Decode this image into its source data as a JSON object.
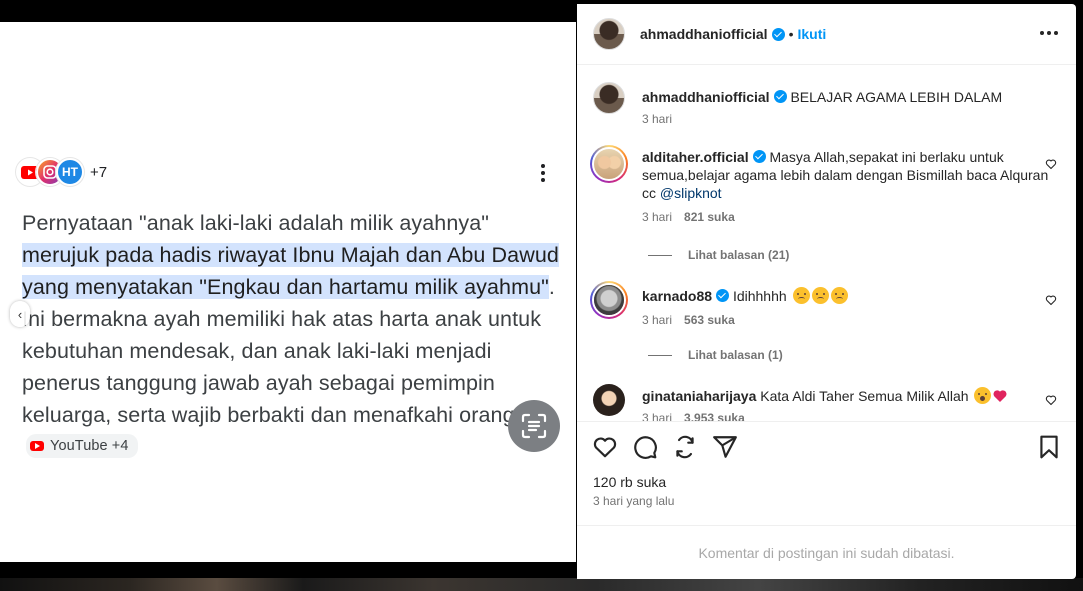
{
  "image": {
    "source_count": "+7",
    "text_before": "Pernyataan \"anak laki-laki adalah milik ayahnya\" ",
    "highlight": "merujuk pada hadis riwayat Ibnu Majah dan Abu Dawud yang menyatakan \"Engkau dan hartamu milik ayahmu\"",
    "text_after": ". Ini bermakna ayah memiliki hak atas harta anak untuk kebutuhan mendesak, dan anak laki-laki menjadi penerus tanggung jawab ayah sebagai pemimpin keluarga, serta wajib berbakti dan menafkahi orang tua.",
    "chip_label": "YouTube +4"
  },
  "post": {
    "username": "ahmaddhaniofficial",
    "separator": "•",
    "follow_label": "Ikuti",
    "caption": "BELAJAR AGAMA LEBIH DALAM",
    "caption_time": "3 hari",
    "comments": [
      {
        "username": "alditaher.official",
        "text": "Masya Allah,sepakat ini berlaku untuk semua,belajar agama lebih dalam dengan Bismillah baca Alquran cc ",
        "mention": "@slipknot",
        "time": "3 hari",
        "likes": "821 suka",
        "replies": "Lihat balasan (21)"
      },
      {
        "username": "karnado88",
        "text": "Idihhhhh",
        "time": "3 hari",
        "likes": "563 suka",
        "replies": "Lihat balasan (1)"
      },
      {
        "username": "ginataniaharijaya",
        "text": "Kata Aldi Taher Semua Milik Allah",
        "time": "3 hari",
        "likes": "3.953 suka"
      }
    ],
    "likes_total": "120 rb suka",
    "posted_time": "3 hari yang lalu",
    "comments_limited": "Komentar di postingan ini sudah dibatasi."
  },
  "colors": {
    "accent": "#0095f6",
    "highlight": "#d3e3fd",
    "muted": "#737373"
  },
  "icons": [
    "youtube-icon",
    "instagram-icon",
    "more-vert-icon",
    "lens-icon",
    "heart-icon",
    "comment-icon",
    "repost-icon",
    "share-icon",
    "bookmark-icon",
    "verified-icon"
  ]
}
